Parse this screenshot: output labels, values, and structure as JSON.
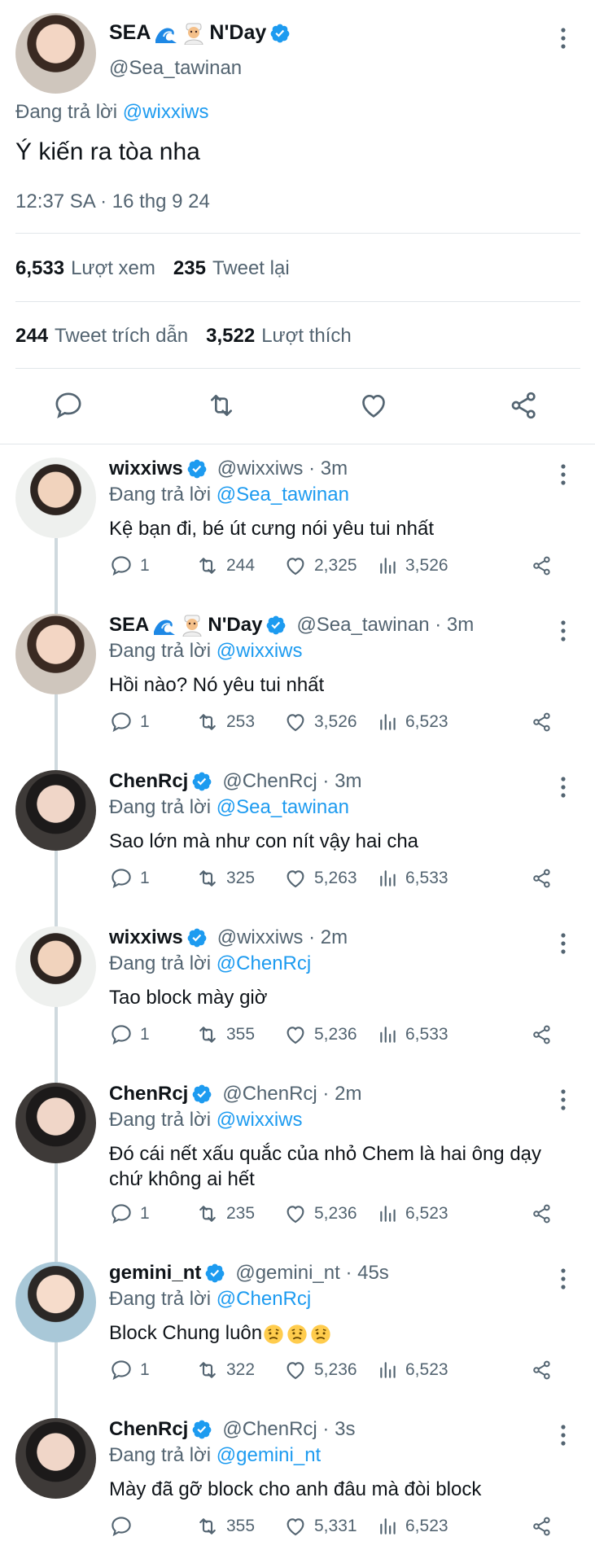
{
  "main_tweet": {
    "author_name": "SEA",
    "author_name_suffix": "N'Day",
    "author_handle": "@Sea_tawinan",
    "replying_prefix": "Đang trả lời",
    "replying_to": "@wixxiws",
    "text": "Ý kiến ra tòa nha",
    "timestamp": "12:37 SA · 16 thg 9 24",
    "views_count": "6,533",
    "views_label": "Lượt xem",
    "retweets_count": "235",
    "retweets_label": "Tweet lại",
    "quotes_count": "244",
    "quotes_label": "Tweet trích dẫn",
    "likes_count": "3,522",
    "likes_label": "Lượt thích"
  },
  "colors": {
    "link": "#1d9bf0",
    "secondary": "#536471",
    "text": "#0f1419",
    "verified": "#1d9bf0",
    "thread_line": "#cfd9de"
  },
  "replies": [
    {
      "name": "wixxiws",
      "name_suffix": "",
      "handle": "@wixxiws · 3m",
      "replying_prefix": "Đang trả lời",
      "replying_to": "@Sea_tawinan",
      "text": "Kệ bạn đi, bé út cưng nói yêu tui nhất",
      "reply_count": "1",
      "retweet_count": "244",
      "like_count": "2,325",
      "view_count": "3,526",
      "avatar": "wixxiws"
    },
    {
      "name": "SEA",
      "name_suffix": "N'Day",
      "handle": "@Sea_tawinan · 3m",
      "replying_prefix": "Đang trả lời",
      "replying_to": "@wixxiws",
      "text": "Hồi nào? Nó yêu tui nhất",
      "reply_count": "1",
      "retweet_count": "253",
      "like_count": "3,526",
      "view_count": "6,523",
      "avatar": "sea"
    },
    {
      "name": "ChenRcj",
      "name_suffix": "",
      "handle": "@ChenRcj · 3m",
      "replying_prefix": "Đang trả lời",
      "replying_to": "@Sea_tawinan",
      "text": "Sao lớn mà như con nít vậy hai cha",
      "reply_count": "1",
      "retweet_count": "325",
      "like_count": "5,263",
      "view_count": "6,533",
      "avatar": "chen"
    },
    {
      "name": "wixxiws",
      "name_suffix": "",
      "handle": "@wixxiws · 2m",
      "replying_prefix": "Đang trả lời",
      "replying_to": "@ChenRcj",
      "text": "Tao block mày giờ",
      "reply_count": "1",
      "retweet_count": "355",
      "like_count": "5,236",
      "view_count": "6,533",
      "avatar": "wixxiws"
    },
    {
      "name": "ChenRcj",
      "name_suffix": "",
      "handle": "@ChenRcj · 2m",
      "replying_prefix": "Đang trả lời",
      "replying_to": "@wixxiws",
      "text": "Đó cái nết xấu quắc của nhỏ Chem là hai ông dạy chứ không ai hết",
      "reply_count": "1",
      "retweet_count": "235",
      "like_count": "5,236",
      "view_count": "6,523",
      "avatar": "chen"
    },
    {
      "name": "gemini_nt",
      "name_suffix": "",
      "handle": "@gemini_nt · 45s",
      "replying_prefix": "Đang trả lời",
      "replying_to": "@ChenRcj",
      "text": "Block Chung luôn",
      "reply_count": "1",
      "retweet_count": "322",
      "like_count": "5,236",
      "view_count": "6,523",
      "avatar": "gemini"
    },
    {
      "name": "ChenRcj",
      "name_suffix": "",
      "handle": "@ChenRcj · 3s",
      "replying_prefix": "Đang trả lời",
      "replying_to": "@gemini_nt",
      "text": "Mày đã gỡ block cho anh đâu mà đòi block",
      "reply_count": "",
      "retweet_count": "355",
      "like_count": "5,331",
      "view_count": "6,523",
      "avatar": "chen"
    }
  ]
}
